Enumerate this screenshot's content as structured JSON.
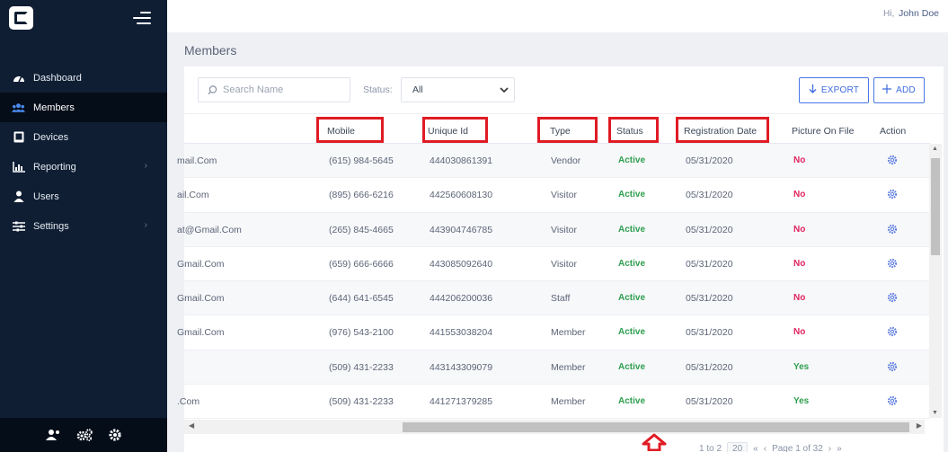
{
  "header": {
    "greeting": "Hi,",
    "user_name": "John Doe"
  },
  "sidebar": {
    "items": [
      {
        "label": "Dashboard",
        "icon": "dashboard-icon",
        "active": false
      },
      {
        "label": "Members",
        "icon": "members-icon",
        "active": true
      },
      {
        "label": "Devices",
        "icon": "devices-icon",
        "active": false
      },
      {
        "label": "Reporting",
        "icon": "reporting-icon",
        "active": false,
        "has_submenu": true
      },
      {
        "label": "Users",
        "icon": "users-icon",
        "active": false
      },
      {
        "label": "Settings",
        "icon": "settings-icon",
        "active": false,
        "has_submenu": true
      }
    ]
  },
  "page": {
    "title": "Members"
  },
  "toolbar": {
    "search_placeholder": "Search Name",
    "status_label": "Status:",
    "status_value": "All",
    "export_label": "EXPORT",
    "add_label": "ADD"
  },
  "table": {
    "columns": [
      "Mobile",
      "Unique Id",
      "Type",
      "Status",
      "Registration Date",
      "Picture On File",
      "Action"
    ],
    "highlighted_columns": [
      "Mobile",
      "Unique Id",
      "Type",
      "Status",
      "Registration Date"
    ],
    "rows": [
      {
        "email": "mail.Com",
        "mobile": "(615) 984-5645",
        "unique_id": "444030861391",
        "type": "Vendor",
        "status": "Active",
        "registration_date": "05/31/2020",
        "picture": "No"
      },
      {
        "email": "ail.Com",
        "mobile": "(895) 666-6216",
        "unique_id": "442560608130",
        "type": "Visitor",
        "status": "Active",
        "registration_date": "05/31/2020",
        "picture": "No"
      },
      {
        "email": "at@Gmail.Com",
        "mobile": "(265) 845-4665",
        "unique_id": "443904746785",
        "type": "Visitor",
        "status": "Active",
        "registration_date": "05/31/2020",
        "picture": "No"
      },
      {
        "email": "Gmail.Com",
        "mobile": "(659) 666-6666",
        "unique_id": "443085092640",
        "type": "Visitor",
        "status": "Active",
        "registration_date": "05/31/2020",
        "picture": "No"
      },
      {
        "email": "Gmail.Com",
        "mobile": "(644) 641-6545",
        "unique_id": "444206200036",
        "type": "Staff",
        "status": "Active",
        "registration_date": "05/31/2020",
        "picture": "No"
      },
      {
        "email": "Gmail.Com",
        "mobile": "(976) 543-2100",
        "unique_id": "441553038204",
        "type": "Member",
        "status": "Active",
        "registration_date": "05/31/2020",
        "picture": "No"
      },
      {
        "email": "",
        "mobile": "(509) 431-2233",
        "unique_id": "443143309079",
        "type": "Member",
        "status": "Active",
        "registration_date": "05/31/2020",
        "picture": "Yes"
      },
      {
        "email": ".Com",
        "mobile": "(509) 431-2233",
        "unique_id": "441271379285",
        "type": "Member",
        "status": "Active",
        "registration_date": "05/31/2020",
        "picture": "Yes"
      }
    ]
  },
  "pagination": {
    "range_text": "1 to 2",
    "page_size": "20",
    "page_text": "Page 1 of 32"
  },
  "colors": {
    "sidebar_bg": "#0f1e33",
    "accent": "#3f6be0",
    "active_status": "#2e9e4f",
    "no_flag": "#e0245e",
    "highlight_box": "#e01b24"
  }
}
